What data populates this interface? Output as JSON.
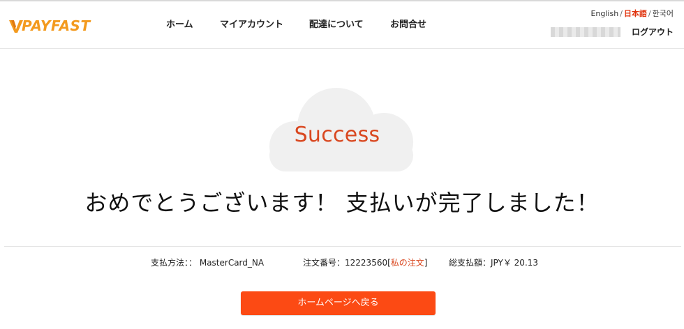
{
  "brand": {
    "logo_text": "PAYFAST",
    "logo_letter": "V",
    "logo_color": "#f39a1e"
  },
  "nav": {
    "items": [
      {
        "label": "ホーム"
      },
      {
        "label": "マイアカウント"
      },
      {
        "label": "配達について"
      },
      {
        "label": "お問合せ"
      }
    ]
  },
  "languages": {
    "items": [
      {
        "label": "English",
        "active": false
      },
      {
        "label": "日本語",
        "active": true
      },
      {
        "label": "한국어",
        "active": false
      }
    ],
    "separator": "/"
  },
  "account": {
    "logout_label": "ログアウト"
  },
  "hero": {
    "badge_text": "Success",
    "message": "おめでとうございます！ 支払いが完了しました！",
    "cloud_icon": "cloud-icon"
  },
  "payment_info": {
    "method_label": "支払方法：：",
    "method_value": "MasterCard_NA",
    "order_label": "注文番号：",
    "order_value": "12223560",
    "order_link_open": "[",
    "order_link_text": "私の注文",
    "order_link_close": "]",
    "total_label": "総支払額：",
    "total_value": "JPY￥ 20.13"
  },
  "actions": {
    "home_button_label": "ホームページへ戻る"
  },
  "colors": {
    "accent": "#fc4a14",
    "success_text": "#d9471f",
    "link": "#d9471f",
    "active_lang": "#e0310b"
  }
}
